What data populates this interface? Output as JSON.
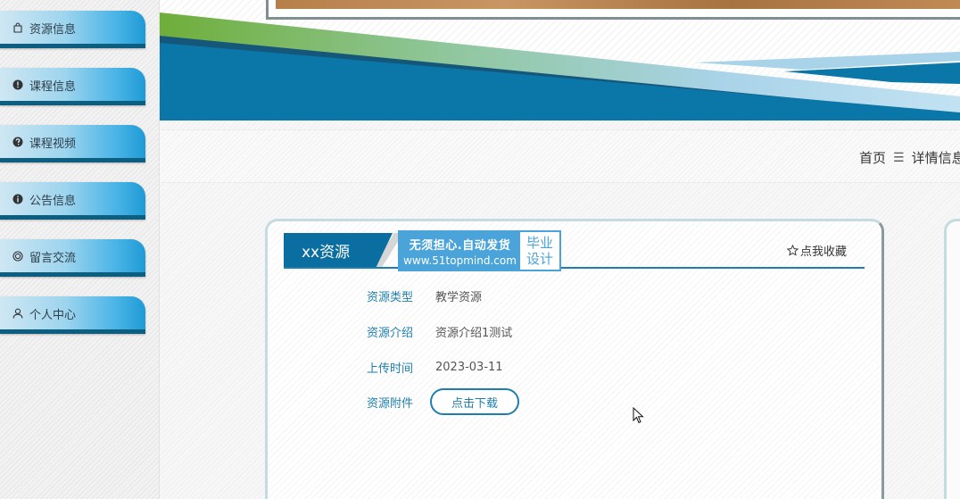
{
  "sidebar": {
    "items": [
      {
        "label": "资源信息",
        "icon": "bag-icon"
      },
      {
        "label": "课程信息",
        "icon": "exclamation-circle-icon"
      },
      {
        "label": "课程视频",
        "icon": "question-circle-icon"
      },
      {
        "label": "公告信息",
        "icon": "info-circle-icon"
      },
      {
        "label": "留言交流",
        "icon": "target-icon"
      },
      {
        "label": "个人中心",
        "icon": "user-icon"
      }
    ]
  },
  "breadcrumb": {
    "home": "首页",
    "separator": "☰",
    "current": "详情信息"
  },
  "detail": {
    "title": "xx资源",
    "favorite_label": "点我收藏",
    "fields": {
      "type_label": "资源类型",
      "type_value": "教学资源",
      "intro_label": "资源介绍",
      "intro_value": "资源介绍1测试",
      "upload_label": "上传时间",
      "upload_value": "2023-03-11",
      "attachment_label": "资源附件",
      "download_button": "点击下载"
    }
  },
  "watermark": {
    "line1": "无须担心.自动发货",
    "line2": "www.51topmind.com",
    "right_line1": "毕业",
    "right_line2": "设计"
  },
  "colors": {
    "accent": "#1e7fae",
    "title_bg": "#0a6fa0",
    "watermark": "#4aa3d9"
  }
}
